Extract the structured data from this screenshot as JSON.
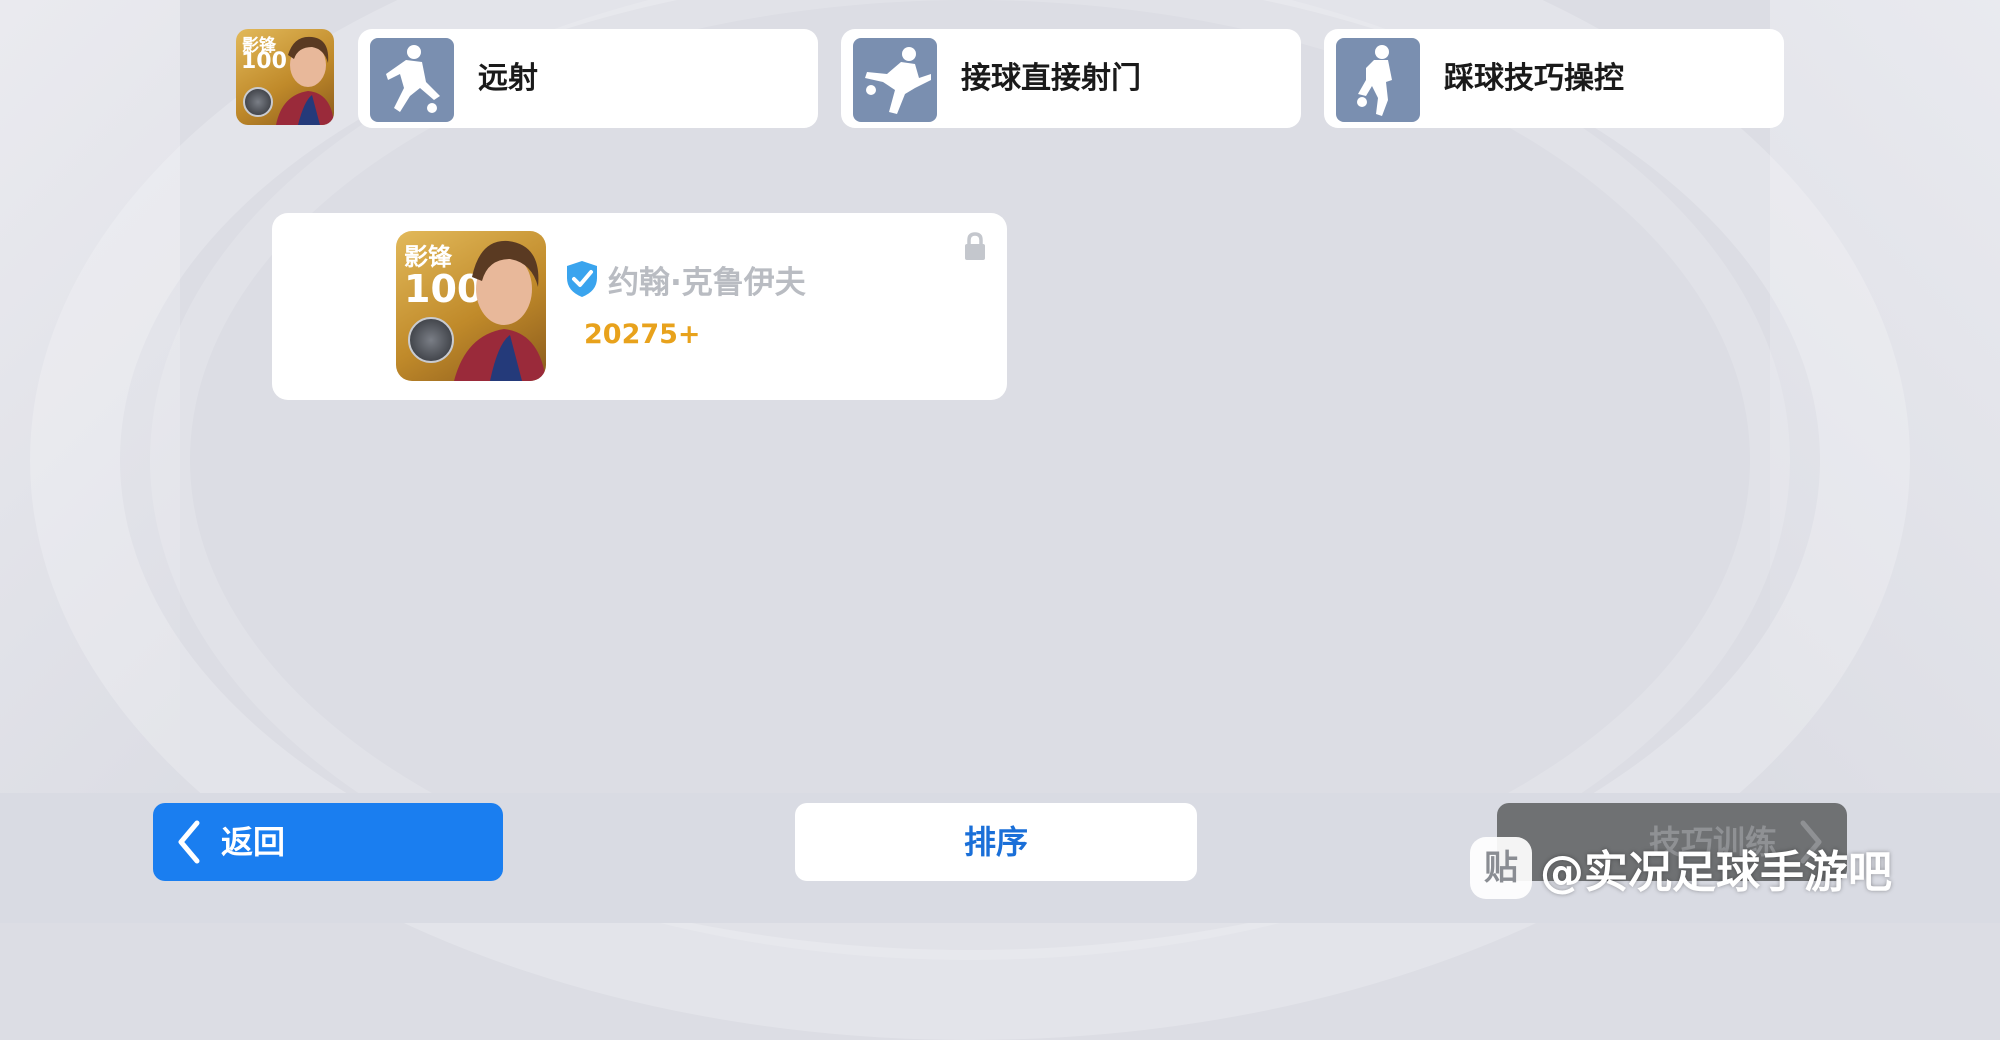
{
  "header": {
    "player_card": {
      "position": "影锋",
      "rating": "100"
    },
    "skills": [
      {
        "label": "远射",
        "icon": "long-shot-icon"
      },
      {
        "label": "接球直接射门",
        "icon": "first-time-shot-icon"
      },
      {
        "label": "踩球技巧操控",
        "icon": "sole-control-icon"
      }
    ]
  },
  "player": {
    "card": {
      "position": "影锋",
      "rating": "100"
    },
    "name": "约翰·克鲁伊夫",
    "points": "20275+",
    "verified_icon": "verified-shield-icon",
    "lock_icon": "lock-icon"
  },
  "footer": {
    "back_label": "返回",
    "sort_label": "排序",
    "train_label": "技巧训练"
  },
  "watermark": {
    "logo_glyph": "贴",
    "text": "@实况足球手游吧"
  },
  "colors": {
    "primary_blue": "#1a7ef0",
    "points_orange": "#e8a21c",
    "skill_icon_bg": "#7a8fb0",
    "disabled_button": "#6f7173"
  }
}
